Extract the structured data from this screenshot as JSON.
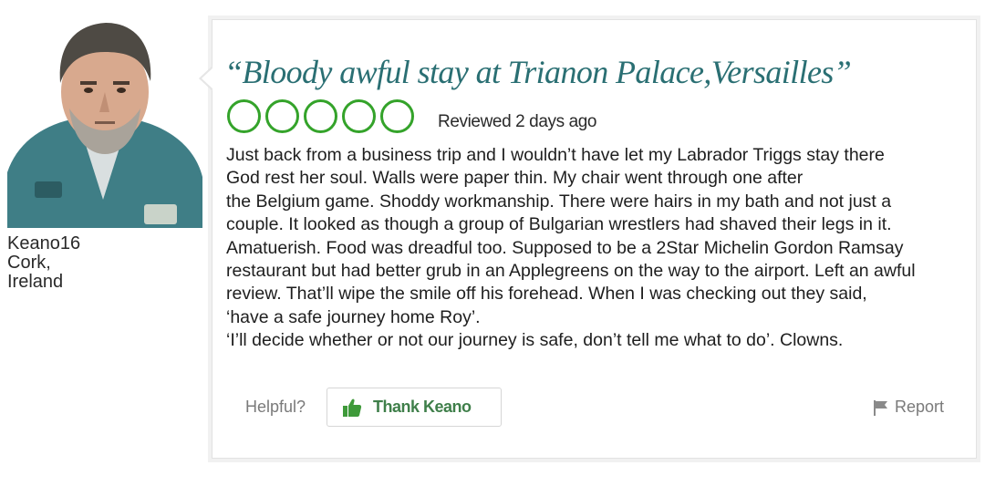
{
  "reviewer": {
    "username": "Keano16",
    "location_line1": "Cork,",
    "location_line2": "Ireland"
  },
  "review": {
    "title": "“Bloody awful stay at Trianon Palace,Versailles”",
    "rating": {
      "value": 5,
      "max": 5,
      "filled": false,
      "icon": "rating-bubble-icon"
    },
    "reviewed_date": "Reviewed 2 days ago",
    "body_lines": [
      "Just back from a business trip and I wouldn’t have let my Labrador Triggs stay there",
      "God rest her soul. Walls were paper thin. My chair went through one after",
      "the Belgium game. Shoddy workmanship. There were hairs in my bath and not just a",
      "couple. It looked as though a group of Bulgarian wrestlers had shaved their legs in it.",
      "Amatuerish. Food was dreadful too. Supposed to be a 2Star Michelin Gordon Ramsay",
      "restaurant but had better grub in an Applegreens on the way to the airport. Left an awful",
      "review. That’ll wipe the smile off his forehead. When I was checking out they said,",
      "‘have a safe journey home Roy’.",
      "‘I’ll decide whether or not our journey is safe, don’t tell me what to do’. Clowns."
    ]
  },
  "actions": {
    "helpful_label": "Helpful?",
    "thank_label": "Thank Keano",
    "thank_icon": "thumbs-up-icon",
    "report_label": "Report",
    "report_icon": "flag-icon"
  },
  "colors": {
    "title": "#2a6f73",
    "rating_bubble": "#34a32a",
    "thank_text": "#3f7f4a",
    "muted_text": "#7a7a7a"
  }
}
